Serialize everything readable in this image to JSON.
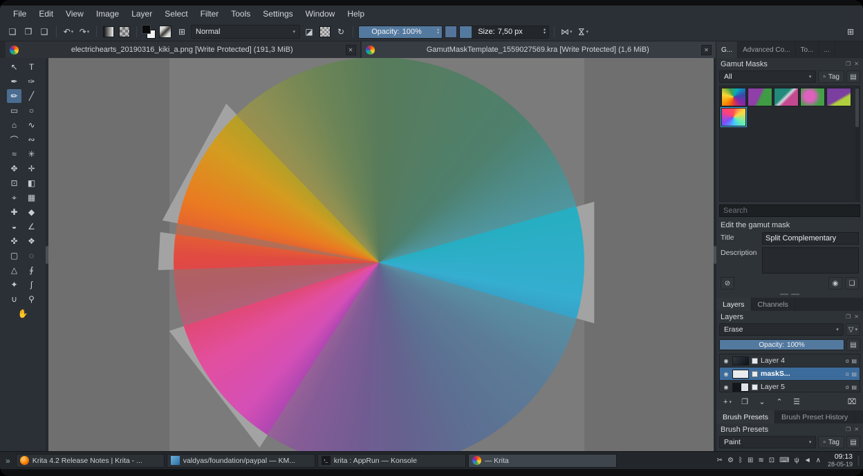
{
  "colors": {
    "accent": "#3daee9",
    "selection": "#3c6c9c",
    "slider_fill": "#54799f"
  },
  "icons": {
    "caret": "▾",
    "box": "▫",
    "grid": "▤",
    "funnel": "▽",
    "spin_up": "▴",
    "spin_down": "▾"
  },
  "docker_icons": {
    "float": "❐",
    "close": "✕"
  },
  "menu_items": [
    "File",
    "Edit",
    "View",
    "Image",
    "Layer",
    "Select",
    "Filter",
    "Tools",
    "Settings",
    "Window",
    "Help"
  ],
  "toolbar": {
    "new_icon": "❏",
    "open_icon": "❐",
    "save_icon": "❑",
    "undo_icon": "↶",
    "redo_icon": "↷",
    "brush_editor_icon": "⊞",
    "blend_mode": "Normal",
    "eraser_icon": "◪",
    "reload_icon": "↻",
    "opacity_label": "Opacity:",
    "opacity_value": "100%",
    "size_label": "Size:",
    "size_value": "7,50 px",
    "mirror_h_icon": "⋈",
    "mirror_v_icon": "⋈",
    "workspace_icon": "⊞"
  },
  "document_tabs": [
    {
      "n": "document-tab-kiki",
      "title": "electrichearts_20190316_kiki_a.png [Write Protected]  (191,3 MiB)",
      "close_icon": "✕"
    },
    {
      "n": "document-tab-gamut-template",
      "title": "GamutMaskTemplate_1559027569.kra [Write Protected]  (1,6 MiB)",
      "close_icon": "✕",
      "active": true
    }
  ],
  "docker_tabs": [
    {
      "n": "docker-tab-gamut-masks",
      "label": "G...",
      "active": true
    },
    {
      "n": "docker-tab-advanced-color",
      "label": "Advanced Co..."
    },
    {
      "n": "docker-tab-tools",
      "label": "To..."
    },
    {
      "n": "docker-tab-more",
      "label": "..."
    }
  ],
  "toolbox": {
    "tools": [
      {
        "n": "select-shapes-tool",
        "g": "↖"
      },
      {
        "n": "text-tool",
        "g": "T"
      },
      {
        "n": "edit-shapes-tool",
        "g": "✒"
      },
      {
        "n": "calligraphy-tool",
        "g": "✑"
      },
      {
        "n": "freehand-brush-tool",
        "g": "✏",
        "active": true
      },
      {
        "n": "line-tool",
        "g": "╱"
      },
      {
        "n": "rectangle-tool",
        "g": "▭"
      },
      {
        "n": "ellipse-tool",
        "g": "○"
      },
      {
        "n": "polygon-tool",
        "g": "⌂"
      },
      {
        "n": "polyline-tool",
        "g": "∿"
      },
      {
        "n": "bezier-curve-tool",
        "g": "⌒"
      },
      {
        "n": "freehand-path-tool",
        "g": "∾"
      },
      {
        "n": "dynamic-brush-tool",
        "g": "≈"
      },
      {
        "n": "multibrush-tool",
        "g": "✳"
      },
      {
        "n": "transform-tool",
        "g": "✥"
      },
      {
        "n": "move-tool",
        "g": "✛"
      },
      {
        "n": "crop-tool",
        "g": "⊡"
      },
      {
        "n": "gradient-tool",
        "g": "◧"
      },
      {
        "n": "color-sampler-tool",
        "g": "⌖"
      },
      {
        "n": "pattern-edit-tool",
        "g": "▦"
      },
      {
        "n": "smart-patch-tool",
        "g": "✚"
      },
      {
        "n": "fill-tool",
        "g": "◆"
      },
      {
        "n": "colorize-mask-tool",
        "g": "◒"
      },
      {
        "n": "measure-tool",
        "g": "∠"
      },
      {
        "n": "assistants-tool",
        "g": "✜"
      },
      {
        "n": "reference-images-tool",
        "g": "❖"
      },
      {
        "n": "rect-select-tool",
        "g": "▢"
      },
      {
        "n": "ellipse-select-tool",
        "g": "◌"
      },
      {
        "n": "polygon-select-tool",
        "g": "△"
      },
      {
        "n": "freehand-select-tool",
        "g": "∮"
      },
      {
        "n": "similar-select-tool",
        "g": "✦"
      },
      {
        "n": "bezier-select-tool",
        "g": "∫"
      },
      {
        "n": "magnetic-select-tool",
        "g": "∪"
      },
      {
        "n": "zoom-tool",
        "g": "⚲"
      },
      {
        "n": "pan-tool",
        "g": "✋"
      }
    ]
  },
  "canvas": {
    "wheel_style": "background: conic-gradient(from 0deg at 50% 50%, #367a3c 0deg, #23825f 45deg, #27aec2 75deg, #35aecf 100deg, #3d7cb0 125deg, #3f64a6 150deg, #4f4aa0 170deg, #643fa5 185deg, #8f3fae 205deg, #d44fb6 222deg, #e24f9e 240deg, #df4353 262deg, #e04b41 272deg, #ea7a21 288deg, #d49c20 305deg, #a2a22b 322deg, #5d8c33 342deg, #367a3c 360deg)"
  },
  "gamut": {
    "header": "Gamut Masks",
    "filter_value": "All",
    "tag_label": "Tag",
    "presets": [
      {
        "n": "gamut-mask-preset-1",
        "style": "background:conic-gradient(from 180deg,#e53935,#fb8c00,#fdd835,#43a047,#00acc1,#3949ab,#8e24aa,#e53935)"
      },
      {
        "n": "gamut-mask-preset-2",
        "style": "background:linear-gradient(115deg,#8e3fa8 45%,#3f9c45 55%)"
      },
      {
        "n": "gamut-mask-preset-3",
        "style": "background:linear-gradient(135deg,#22897b 40%,#cfd8dc 50%,#c2498f 60%)"
      },
      {
        "n": "gamut-mask-preset-4",
        "style": "background:radial-gradient(circle at 38% 45%,#e060c0 28%,#43a047 64%)"
      },
      {
        "n": "gamut-mask-preset-5",
        "style": "background:linear-gradient(150deg,#7b3fa0 55%,#afcf3f 65%)"
      },
      {
        "n": "gamut-mask-preset-split-complementary",
        "style": "background:conic-gradient(#ff5252,#ffd740,#69f0ae,#40c4ff,#7c4dff,#ff4081,#ff5252)",
        "active": true
      }
    ],
    "search_placeholder": "Search",
    "edit_label": "Edit the gamut mask",
    "title_label": "Title",
    "title_value": "Split Complementary",
    "description_label": "Description",
    "clear_icon": "⊘",
    "preview_icon": "◉",
    "save_icon": "❑"
  },
  "layers": {
    "tabs": [
      {
        "n": "tab-layers",
        "label": "Layers",
        "active": true
      },
      {
        "n": "tab-channels",
        "label": "Channels"
      }
    ],
    "header": "Layers",
    "blend_mode": "Erase",
    "opacity_label": "Opacity:",
    "opacity_value": "100%",
    "rows": [
      {
        "n": "layer-row-layer4",
        "eye": "◉",
        "name": "Layer 4",
        "thumb": "background:linear-gradient(135deg,#303a44,#0f1216)",
        "alpha_icon": "α",
        "style_icon": "▤"
      },
      {
        "n": "layer-row-masks",
        "eye": "◉",
        "name": "maskS...",
        "thumb": "background:#e9ecee",
        "alpha_icon": "α",
        "style_icon": "▤",
        "selected": true
      },
      {
        "n": "layer-row-layer5",
        "eye": "◉",
        "name": "Layer 5",
        "thumb": "background:linear-gradient(90deg,#14171a 55%,#dfe3e6 55%)",
        "alpha_icon": "α",
        "style_icon": "▤"
      }
    ],
    "add_icon": "+",
    "dup_icon": "❐",
    "down_icon": "⌄",
    "up_icon": "⌃",
    "props_icon": "☰",
    "del_icon": "⌧"
  },
  "brush": {
    "tabs": [
      {
        "n": "tab-brush-presets",
        "label": "Brush Presets",
        "active": true
      },
      {
        "n": "tab-brush-preset-history",
        "label": "Brush Preset History"
      }
    ],
    "header": "Brush Presets",
    "filter_value": "Paint",
    "tag_label": "Tag",
    "presets": [
      {
        "n": "brush-preset-1",
        "style": "background:linear-gradient(135deg,#e8e8e6 30%,#4a4540 50%,#e8e8e6 70%)",
        "active": true
      },
      {
        "n": "brush-preset-2",
        "style": "background:linear-gradient(135deg,#dededc 25%,#6b655f 50%,#dededc 75%)"
      },
      {
        "n": "brush-preset-3",
        "style": "background:linear-gradient(120deg,#d4d4d2 30%,#3a3631 55%,#d4d4d2 80%)"
      },
      {
        "n": "brush-preset-4",
        "style": "background:linear-gradient(135deg,#e0e0de 20%,#57514a 45%,#e0e0de 75%)"
      },
      {
        "n": "brush-preset-5",
        "style": "background:linear-gradient(150deg,#d8d8d6 30%,#45413c 55%,#d8d8d6 78%)"
      },
      {
        "n": "brush-preset-6",
        "style": "background:linear-gradient(135deg,#e4e4e2 32%,#605a52 52%,#e4e4e2 72%)"
      },
      {
        "n": "brush-preset-7",
        "style": "background:linear-gradient(125deg,#dcdcda 28%,#39352f 52%,#dcdcda 76%)"
      },
      {
        "n": "brush-preset-8",
        "style": "background:linear-gradient(140deg,#e6e6e4 30%,#524c45 50%,#e6e6e4 70%)"
      },
      {
        "n": "brush-preset-9",
        "style": "background:linear-gradient(135deg,#d2d2d0 26%,#433f39 50%,#d2d2d0 74%)"
      }
    ]
  },
  "task_panel": {
    "launcher_icon": "»",
    "tasks": [
      {
        "n": "task-firefox",
        "label": "Krita 4.2 Release Notes | Krita - ...",
        "icon": "background:radial-gradient(circle at 35% 35%, #ffb64d 20%, #f57c00 55%, #d84315 100%);border-radius:50%"
      },
      {
        "n": "task-kmail",
        "label": "valdyas/foundation/paypal — KM...",
        "icon": "background:linear-gradient(135deg,#6fb3e0,#2d6da3)"
      },
      {
        "n": "task-konsole",
        "label": "krita : AppRun — Konsole",
        "icon": "background:#16181b",
        "glyph": "›_"
      },
      {
        "n": "task-krita",
        "label": "— Krita",
        "icon": "background:conic-gradient(#e53935,#fb8c00,#fdd835,#43a047,#1e88e5,#8e24aa,#e53935);border-radius:50%",
        "active": true
      }
    ],
    "tray": [
      {
        "n": "clipboard-tray-icon",
        "g": "✂"
      },
      {
        "n": "settings-tray-icon",
        "g": "⚙"
      },
      {
        "n": "bluetooth-tray-icon",
        "g": "ᛒ"
      },
      {
        "n": "kdeconnect-tray-icon",
        "g": "⊞"
      },
      {
        "n": "network-tray-icon",
        "g": "≋"
      },
      {
        "n": "display-tray-icon",
        "g": "⊡"
      },
      {
        "n": "keyboard-tray-icon",
        "g": "⌨"
      },
      {
        "n": "usb-tray-icon",
        "g": "ψ"
      },
      {
        "n": "volume-tray-icon",
        "g": "◄"
      },
      {
        "n": "expand-tray-icon",
        "g": "∧"
      }
    ],
    "time": "09:13",
    "date": "28-05-19"
  }
}
